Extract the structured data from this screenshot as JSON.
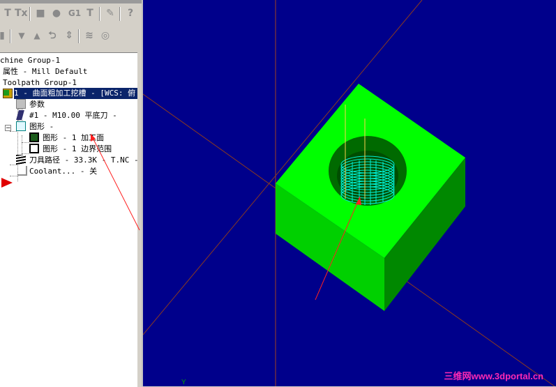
{
  "toolbar1": {
    "buttons": [
      {
        "name": "toolpath-select-icon",
        "glyph": "T"
      },
      {
        "name": "toolpath-clear-icon",
        "glyph": "Tx"
      },
      {
        "name": "verify-solid-icon",
        "glyph": "■"
      },
      {
        "name": "backplot-icon",
        "glyph": "●"
      },
      {
        "name": "post-g1-button",
        "label": "G1"
      },
      {
        "name": "toolpath-move-icon",
        "glyph": "T"
      },
      {
        "name": "tool-manager-icon",
        "glyph": "✎"
      },
      {
        "name": "help-icon",
        "glyph": "?"
      }
    ]
  },
  "toolbar2": {
    "buttons": [
      {
        "name": "lock-icon",
        "glyph": "▮"
      },
      {
        "name": "move-down-icon",
        "glyph": "▼"
      },
      {
        "name": "move-up-icon",
        "glyph": "▲"
      },
      {
        "name": "insert-arrow-icon",
        "glyph": "⮌"
      },
      {
        "name": "updown-arrows-icon",
        "glyph": "⇕"
      },
      {
        "name": "wave-filter-icon",
        "glyph": "≋"
      },
      {
        "name": "target-icon",
        "glyph": "◎"
      }
    ]
  },
  "tree": {
    "machine_group": "chine Group-1",
    "properties": "属性 - Mill Default",
    "toolpath_group": "Toolpath Group-1",
    "operation": "1 - 曲面粗加工挖槽 - [WCS: 俯",
    "params": "参数",
    "tool": "#1 - M10.00 平底刀 -",
    "geometry": "图形 -",
    "geom_surface": "图形 - 1 加工面",
    "geom_boundary": "图形 - 1 边界范围",
    "toolpath": "刀具路径 - 33.3K - T.NC -",
    "coolant": "Coolant... - 关"
  },
  "viewport": {
    "axis_label": "Y",
    "watermark": "三维网www.3dportal.cn",
    "colors": {
      "background": "#00008b",
      "stock_top": "#00ff00",
      "stock_left": "#00cc00",
      "stock_right": "#009a00",
      "toolpath": "#00e5d0",
      "axis": "#a04020"
    }
  }
}
